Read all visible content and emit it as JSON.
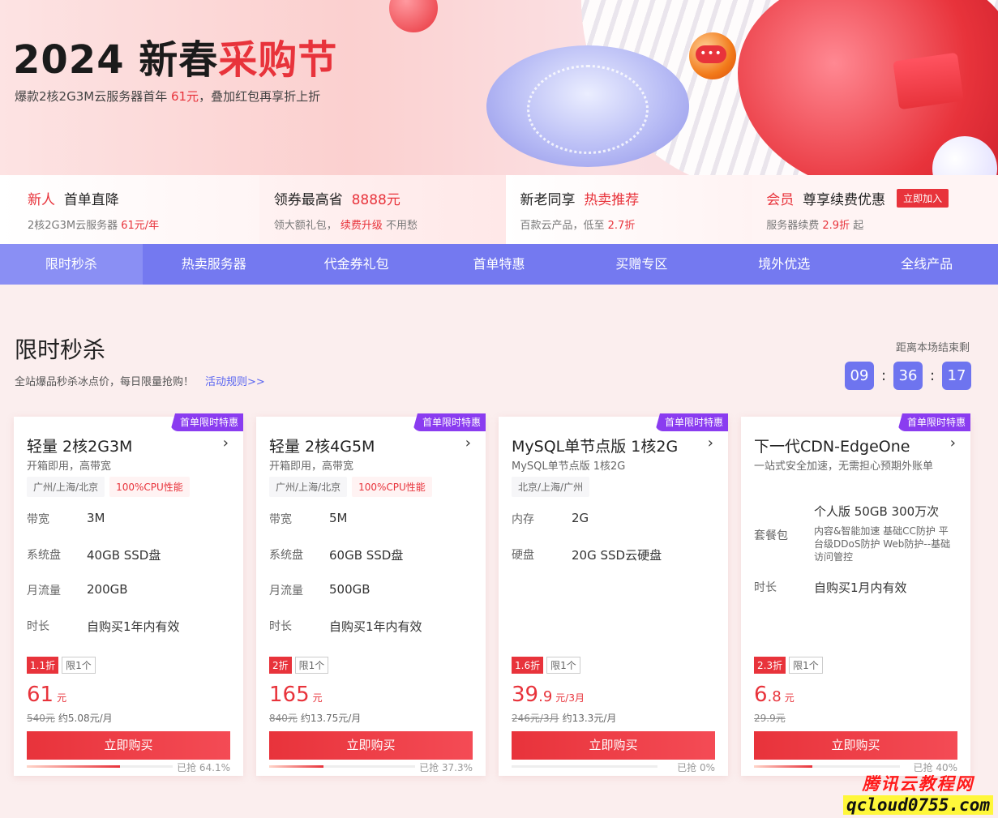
{
  "hero": {
    "title_main": "2024 新春",
    "title_red": "采购节",
    "sub_pre": "爆款2核2G3M云服务器首年 ",
    "sub_red": "61元",
    "sub_post": "，叠加红包再享折上折"
  },
  "benefits": [
    {
      "red": "新人",
      "title": "首单直降",
      "desc_pre": "2核2G3M云服务器 ",
      "desc_red": "61元/年",
      "desc_post": ""
    },
    {
      "title": "领券最高省",
      "red": "8888元",
      "desc_pre": "领大额礼包，",
      "desc_red": "续费升级",
      "desc_post": " 不用愁"
    },
    {
      "title": "新老同享",
      "red": "热卖推荐",
      "desc_pre": "百款云产品，低至 ",
      "desc_red": "2.7折",
      "desc_post": ""
    },
    {
      "red": "会员",
      "title": "尊享续费优惠",
      "button": "立即加入",
      "desc_pre": "服务器续费 ",
      "desc_red": "2.9折",
      "desc_post": " 起"
    }
  ],
  "nav": [
    "限时秒杀",
    "热卖服务器",
    "代金券礼包",
    "首单特惠",
    "买赠专区",
    "境外优选",
    "全线产品"
  ],
  "section": {
    "title": "限时秒杀",
    "subtitle": "全站爆品秒杀冰点价，每日限量抢购！",
    "rules_link": "活动规则>>",
    "countdown_label": "距离本场结束剩",
    "hours": "09",
    "minutes": "36",
    "seconds": "17",
    "sep": ":"
  },
  "cards": [
    {
      "badge": "首单限时特惠",
      "title": "轻量 2核2G3M",
      "subtitle": "开箱即用，高带宽",
      "tags": [
        "广州/上海/北京",
        "100%CPU性能"
      ],
      "specs": [
        [
          "带宽",
          "3M"
        ],
        [
          "系统盘",
          "40GB SSD盘"
        ],
        [
          "月流量",
          "200GB"
        ],
        [
          "时长",
          "自购买1年内有效"
        ]
      ],
      "discount": "1.1折",
      "limit": "限1个",
      "price_int": "61",
      "price_dec": "",
      "price_unit": "元",
      "orig_price": "540元",
      "per_month": "约5.08元/月",
      "buy": "立即购买",
      "sold_text": "已抢 64.1%",
      "sold_fraction": 0.641
    },
    {
      "badge": "首单限时特惠",
      "title": "轻量 2核4G5M",
      "subtitle": "开箱即用，高带宽",
      "tags": [
        "广州/上海/北京",
        "100%CPU性能"
      ],
      "specs": [
        [
          "带宽",
          "5M"
        ],
        [
          "系统盘",
          "60GB SSD盘"
        ],
        [
          "月流量",
          "500GB"
        ],
        [
          "时长",
          "自购买1年内有效"
        ]
      ],
      "discount": "2折",
      "limit": "限1个",
      "price_int": "165",
      "price_dec": "",
      "price_unit": "元",
      "orig_price": "840元",
      "per_month": "约13.75元/月",
      "buy": "立即购买",
      "sold_text": "已抢 37.3%",
      "sold_fraction": 0.373
    },
    {
      "badge": "首单限时特惠",
      "title": "MySQL单节点版 1核2G",
      "subtitle": "MySQL单节点版 1核2G",
      "tags": [
        "北京/上海/广州"
      ],
      "specs": [
        [
          "内存",
          "2G"
        ],
        [
          "硬盘",
          "20G SSD云硬盘"
        ]
      ],
      "discount": "1.6折",
      "limit": "限1个",
      "price_int": "39",
      "price_dec": ".9",
      "price_unit": "元/3月",
      "orig_price": "246元/3月",
      "per_month": "约13.3元/月",
      "buy": "立即购买",
      "sold_text": "已抢 0%",
      "sold_fraction": 0
    },
    {
      "badge": "首单限时特惠",
      "title": "下一代CDN-EdgeOne",
      "subtitle": "一站式安全加速，无需担心预期外账单",
      "package": {
        "label": "套餐包",
        "main": "个人版 50GB 300万次",
        "desc": "内容&智能加速 基础CC防护 平台级DDoS防护 Web防护--基础访问管控"
      },
      "specs": [
        [
          "时长",
          "自购买1月内有效"
        ]
      ],
      "discount": "2.3折",
      "limit": "限1个",
      "price_int": "6",
      "price_dec": ".8",
      "price_unit": "元",
      "orig_price": "29.9元",
      "per_month": "",
      "buy": "立即购买",
      "sold_text": "已抢 40%",
      "sold_fraction": 0.4
    }
  ],
  "watermark": {
    "line1": "腾讯云教程网",
    "line2": "qcloud0755.com"
  },
  "colors": {
    "accent": "#e8333b",
    "nav": "#7479f0",
    "badge": "#8a3cf0",
    "countdown": "#6e74ef"
  }
}
